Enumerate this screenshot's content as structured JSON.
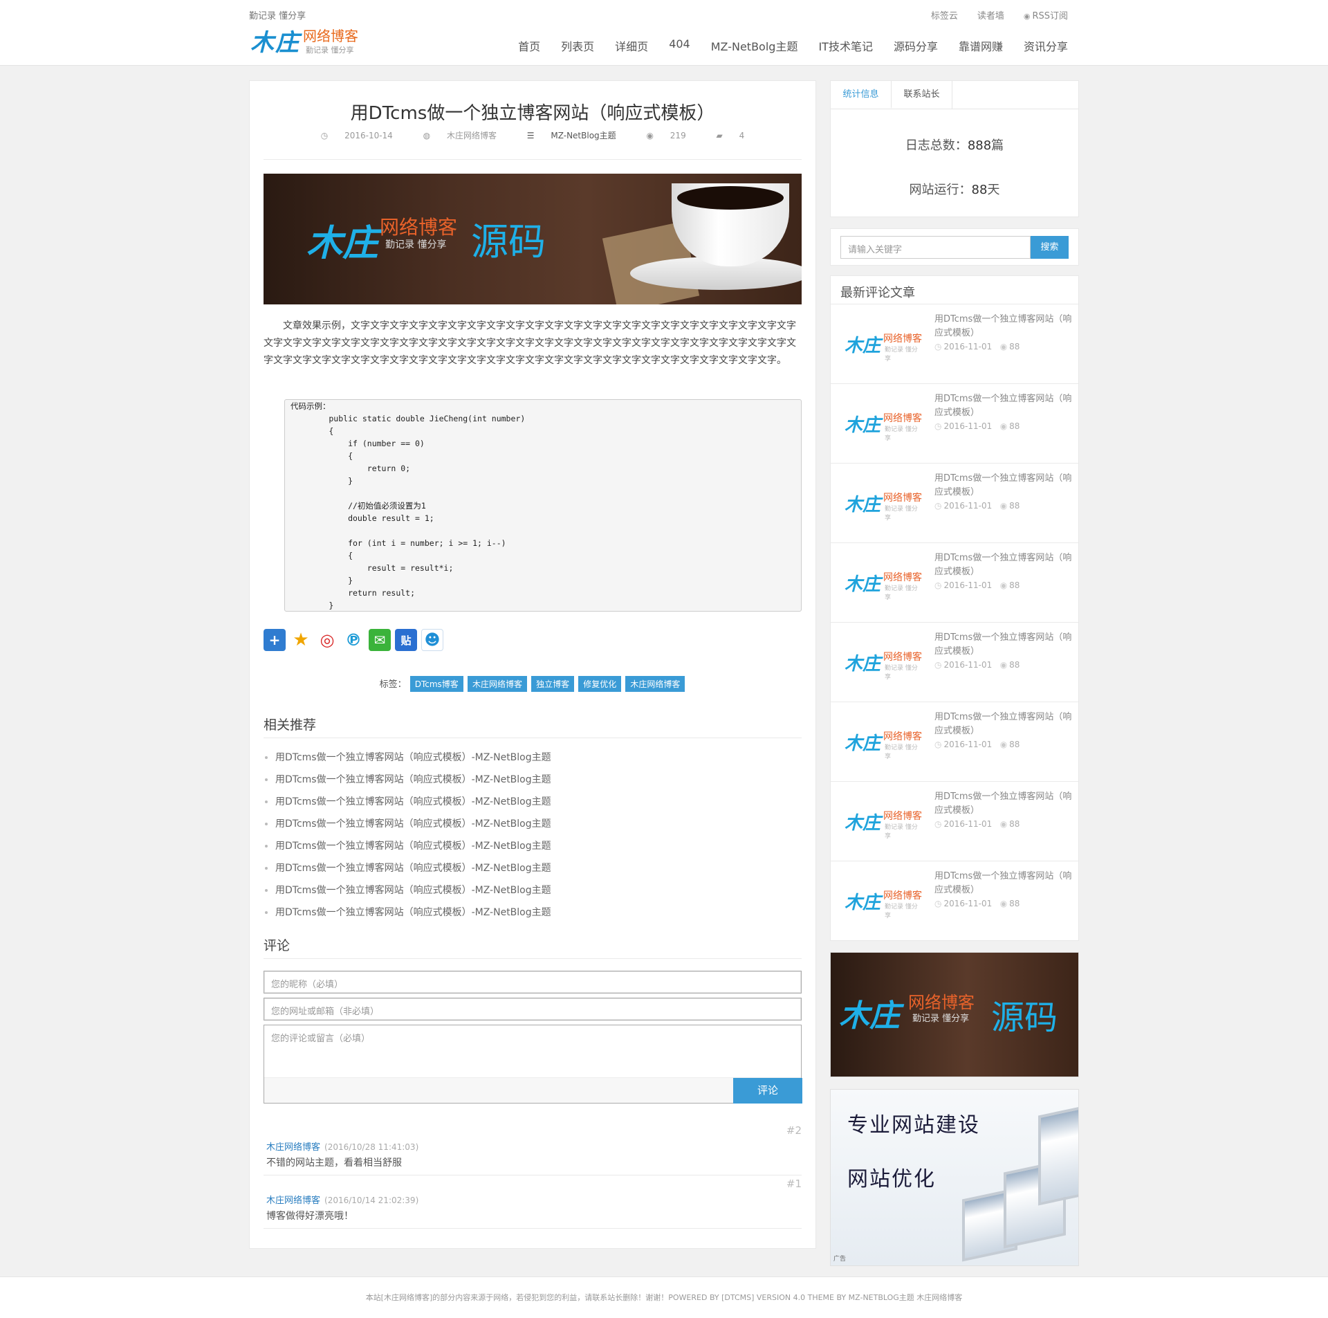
{
  "header": {
    "slogan": "勤记录 懂分享",
    "logo": {
      "main": "木庄",
      "accent": "网络博客",
      "sub": "勤记录 懂分享"
    },
    "toplinks": [
      "标签云",
      "读者墙",
      "RSS订阅"
    ],
    "nav": [
      "首页",
      "列表页",
      "详细页",
      "404",
      "MZ-NetBolg主题",
      "IT技术笔记",
      "源码分享",
      "靠谱网赚",
      "资讯分享"
    ]
  },
  "article": {
    "title": "用DTcms做一个独立博客网站（响应式模板）",
    "date": "2016-10-14",
    "author": "木庄网络博客",
    "category": "MZ-NetBlog主题",
    "views": "219",
    "comments": "4",
    "banner": {
      "main": "木庄",
      "accent": "网络博客",
      "sub": "勤记录  懂分享",
      "tail": "源码"
    },
    "text": "文章效果示例，文字文字文字文字文字文字文字文字文字文字文字文字文字文字文字文字文字文字文字文字文字文字文字文字文字文字文字文字文字文字文字文字文字文字文字文字文字文字文字文字文字文字文字文字文字文字文字文字文字文字文字文字文字文字文字文字文字文字文字文字文字文字文字文字文字文字文字文字文字文字文字文字文字文字文字文字文字。",
    "code": "代码示例：\n        public static double JieCheng(int number)\n        {\n            if (number == 0)\n            {\n                return 0;\n            }\n\n            //初始值必须设置为1\n            double result = 1;\n\n            for (int i = number; i >= 1; i--)\n            {\n                result = result*i;\n            }\n            return result;\n        }",
    "tags_label": "标签：",
    "tags": [
      "DTcms博客",
      "木庄网络博客",
      "独立博客",
      "修复优化",
      "木庄网络博客"
    ]
  },
  "share": {
    "icons": [
      "share-more-icon",
      "qzone-icon",
      "weibo-icon",
      "pinterest-icon",
      "wechat-icon",
      "tieba-icon",
      "qq-icon"
    ],
    "colors": [
      "#2f7cd0",
      "#f0a500",
      "#d92a2a",
      "#1a9ad6",
      "#3ab33a",
      "#2a6fd1",
      "#1f8fd6"
    ]
  },
  "related": {
    "heading": "相关推荐",
    "items": [
      "用DTcms做一个独立博客网站（响应式模板）-MZ-NetBlog主题",
      "用DTcms做一个独立博客网站（响应式模板）-MZ-NetBlog主题",
      "用DTcms做一个独立博客网站（响应式模板）-MZ-NetBlog主题",
      "用DTcms做一个独立博客网站（响应式模板）-MZ-NetBlog主题",
      "用DTcms做一个独立博客网站（响应式模板）-MZ-NetBlog主题",
      "用DTcms做一个独立博客网站（响应式模板）-MZ-NetBlog主题",
      "用DTcms做一个独立博客网站（响应式模板）-MZ-NetBlog主题",
      "用DTcms做一个独立博客网站（响应式模板）-MZ-NetBlog主题"
    ]
  },
  "comment_form": {
    "heading": "评论",
    "nickname_placeholder": "您的昵称（必填）",
    "contact_placeholder": "您的网址或邮箱（非必填）",
    "content_placeholder": "您的评论或留言（必填）",
    "submit": "评论"
  },
  "comments": [
    {
      "floor": "#2",
      "author": "木庄网络博客",
      "time": "(2016/10/28 11:41:03)",
      "text": "不错的网站主题，看着相当舒服"
    },
    {
      "floor": "#1",
      "author": "木庄网络博客",
      "time": "(2016/10/14 21:02:39)",
      "text": "博客做得好漂亮哦！"
    }
  ],
  "sidebar": {
    "tabs": [
      "统计信息",
      "联系站长"
    ],
    "stats": {
      "posts_label": "日志总数：",
      "posts_value": "888",
      "posts_unit": "篇",
      "days_label": "网站运行：",
      "days_value": "88",
      "days_unit": "天"
    },
    "search": {
      "placeholder": "请输入关键字",
      "button": "搜索"
    },
    "latest_heading": "最新评论文章",
    "latest": [
      {
        "title": "用DTcms做一个独立博客网站（响应式模板）",
        "date": "2016-11-01",
        "views": "88"
      },
      {
        "title": "用DTcms做一个独立博客网站（响应式模板）",
        "date": "2016-11-01",
        "views": "88"
      },
      {
        "title": "用DTcms做一个独立博客网站（响应式模板）",
        "date": "2016-11-01",
        "views": "88"
      },
      {
        "title": "用DTcms做一个独立博客网站（响应式模板）",
        "date": "2016-11-01",
        "views": "88"
      },
      {
        "title": "用DTcms做一个独立博客网站（响应式模板）",
        "date": "2016-11-01",
        "views": "88"
      },
      {
        "title": "用DTcms做一个独立博客网站（响应式模板）",
        "date": "2016-11-01",
        "views": "88"
      },
      {
        "title": "用DTcms做一个独立博客网站（响应式模板）",
        "date": "2016-11-01",
        "views": "88"
      },
      {
        "title": "用DTcms做一个独立博客网站（响应式模板）",
        "date": "2016-11-01",
        "views": "88"
      }
    ],
    "thumb": {
      "main": "木庄",
      "accent": "网络博客",
      "sub": "勤记录  懂分享"
    },
    "banner": {
      "main": "木庄",
      "accent": "网络博客",
      "sub": "勤记录  懂分享",
      "tail": "源码"
    },
    "ad": {
      "line1": "专业网站建设",
      "line2": "网站优化",
      "label": "广告"
    }
  },
  "footer": {
    "text": "本站[木庄网络博客]的部分内容来源于网络，若侵犯到您的利益，请联系站长删除！谢谢！POWERED BY [DTCMS] VERSION 4.0 THEME BY MZ-NETBLOG主题 木庄网络博客"
  }
}
